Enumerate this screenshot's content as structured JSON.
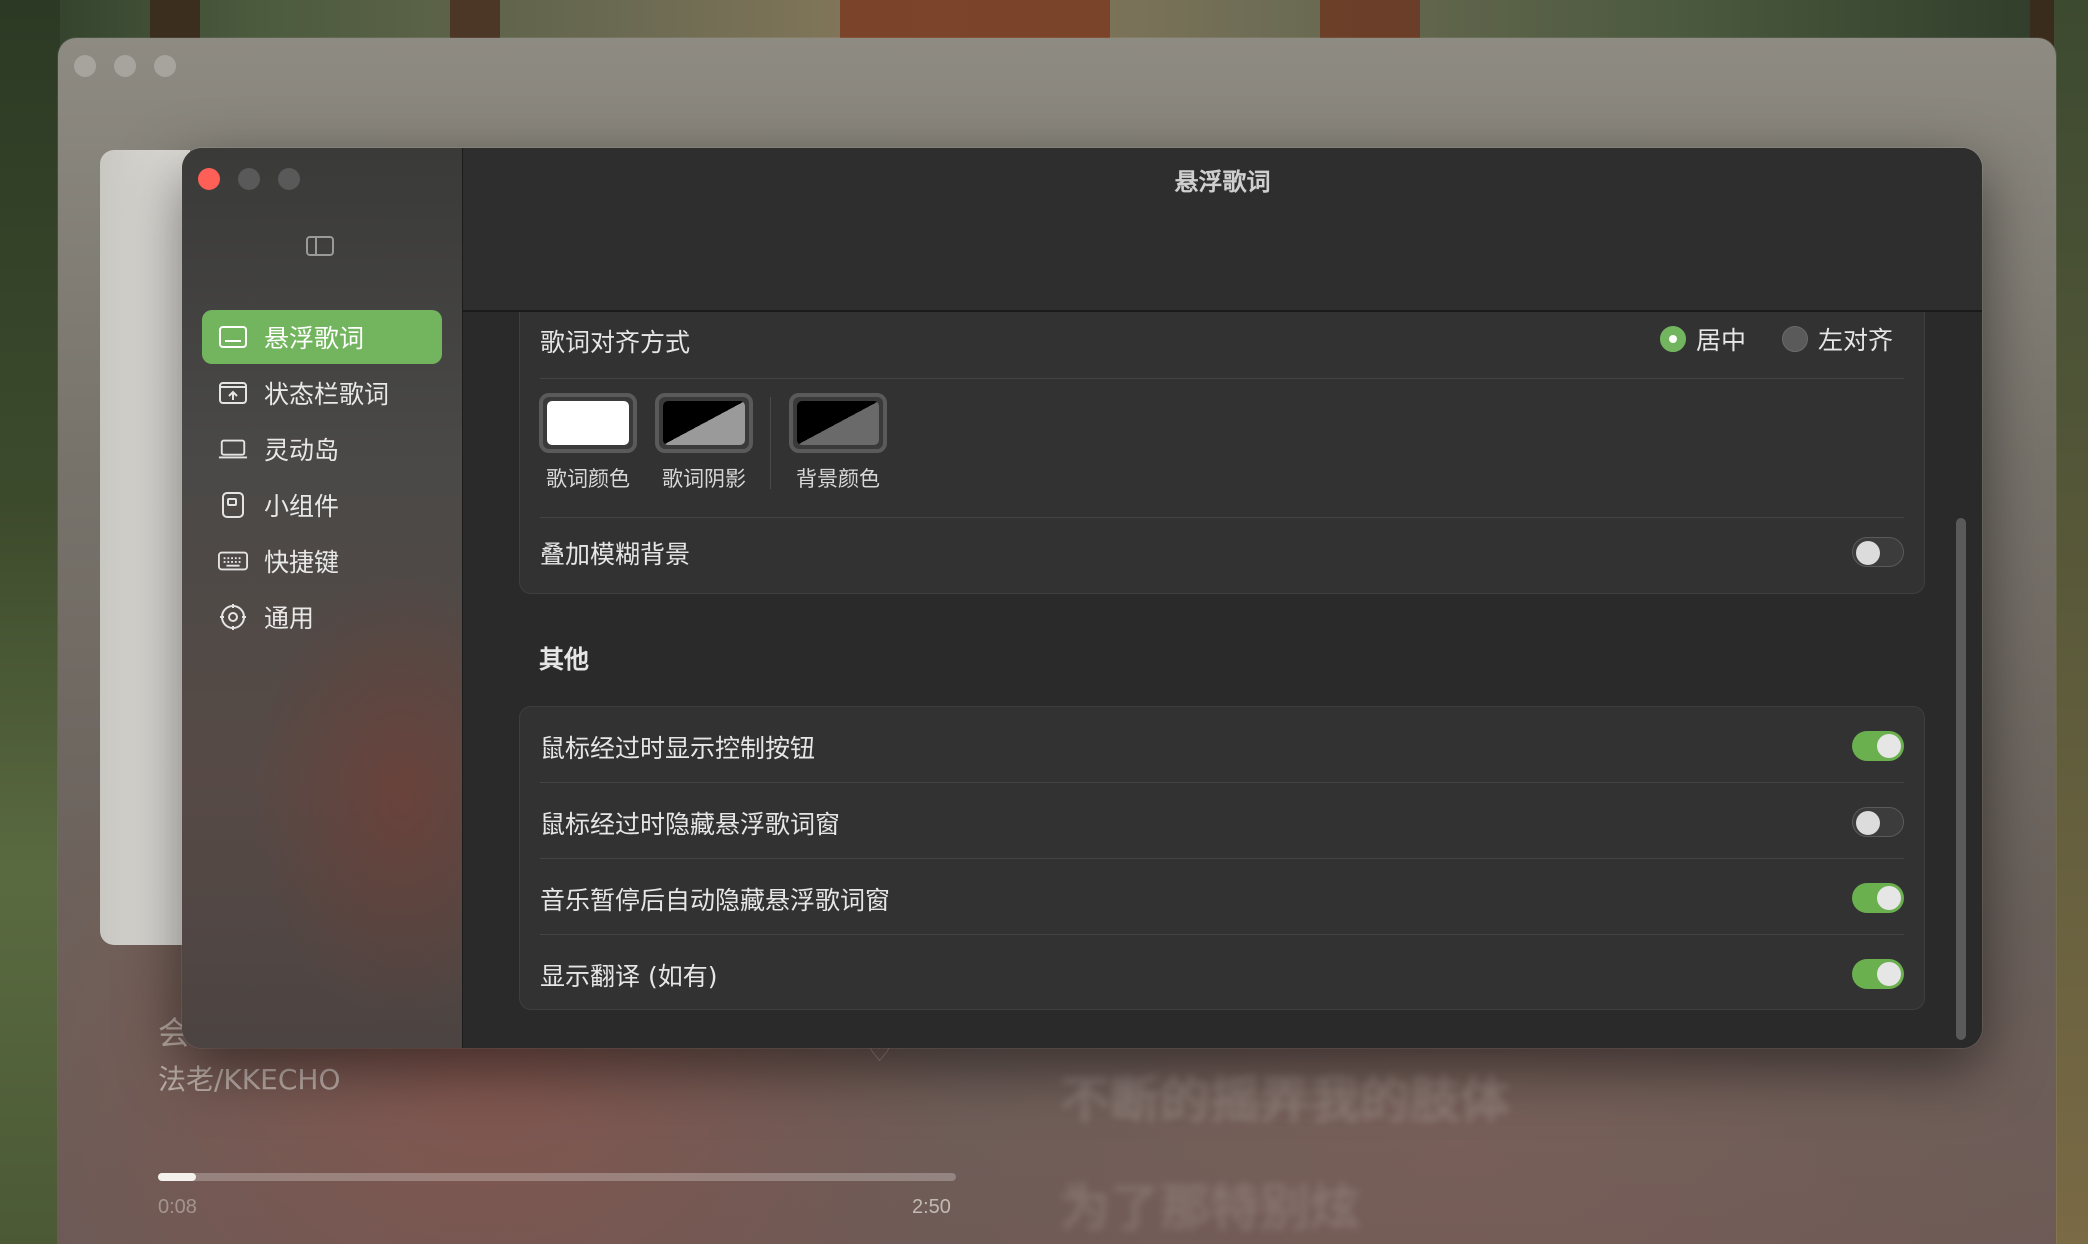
{
  "player": {
    "song_title": "会",
    "artist": "法老/KKECHO",
    "time_elapsed": "0:08",
    "time_total": "2:50",
    "progress": 0.047,
    "lyric_line_1": "不断的摇弄我的肢体",
    "lyric_line_2": "为了那特别炫"
  },
  "settings": {
    "window_title": "悬浮歌词",
    "sidebar": {
      "items": [
        {
          "label": "悬浮歌词",
          "icon": "floating-lyrics-icon",
          "active": true
        },
        {
          "label": "状态栏歌词",
          "icon": "menubar-lyrics-icon",
          "active": false
        },
        {
          "label": "灵动岛",
          "icon": "dynamic-island-icon",
          "active": false
        },
        {
          "label": "小组件",
          "icon": "widget-icon",
          "active": false
        },
        {
          "label": "快捷键",
          "icon": "keyboard-icon",
          "active": false
        },
        {
          "label": "通用",
          "icon": "gear-icon",
          "active": false
        }
      ]
    },
    "appearance": {
      "alignment_label": "歌词对齐方式",
      "alignment_options": [
        {
          "label": "居中",
          "selected": true
        },
        {
          "label": "左对齐",
          "selected": false
        }
      ],
      "swatches": [
        {
          "label": "歌词颜色",
          "colors": [
            "#ffffff",
            "#ffffff"
          ]
        },
        {
          "label": "歌词阴影",
          "colors": [
            "#000000",
            "#9a9a9a"
          ]
        },
        {
          "label": "背景颜色",
          "colors": [
            "#000000",
            "#6a6a6a"
          ]
        }
      ],
      "blur_background_label": "叠加模糊背景",
      "blur_background_on": false
    },
    "other": {
      "section_title": "其他",
      "rows": [
        {
          "label": "鼠标经过时显示控制按钮",
          "on": true
        },
        {
          "label": "鼠标经过时隐藏悬浮歌词窗",
          "on": false
        },
        {
          "label": "音乐暂停后自动隐藏悬浮歌词窗",
          "on": true
        },
        {
          "label": "显示翻译 (如有)",
          "on": true
        }
      ]
    }
  }
}
